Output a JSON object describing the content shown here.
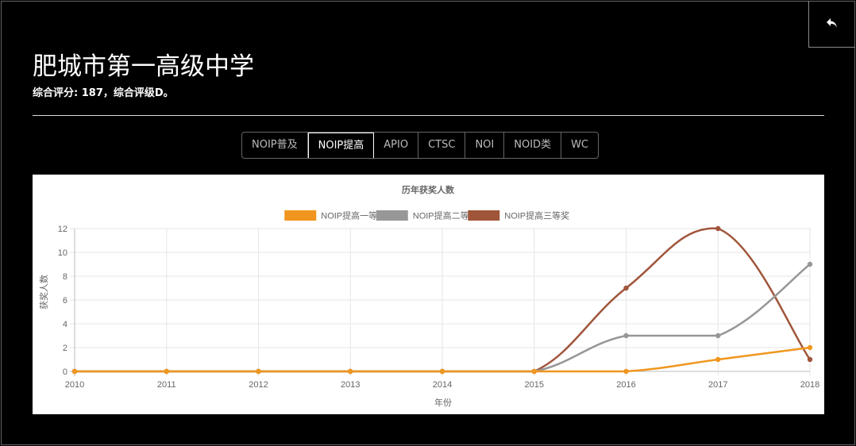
{
  "header": {
    "back_icon": "reply-arrow-icon",
    "title": "肥城市第一高级中学",
    "subtitle": "综合评分: 187，综合评级D。"
  },
  "tabs": [
    {
      "label": "NOIP普及",
      "active": false
    },
    {
      "label": "NOIP提高",
      "active": true
    },
    {
      "label": "APIO",
      "active": false
    },
    {
      "label": "CTSC",
      "active": false
    },
    {
      "label": "NOI",
      "active": false
    },
    {
      "label": "NOID类",
      "active": false
    },
    {
      "label": "WC",
      "active": false
    }
  ],
  "chart_data": {
    "type": "line",
    "title": "历年获奖人数",
    "xlabel": "年份",
    "ylabel": "获奖人数",
    "x": [
      "2010",
      "2011",
      "2012",
      "2013",
      "2014",
      "2015",
      "2016",
      "2017",
      "2018"
    ],
    "ylim": [
      0,
      12
    ],
    "yticks": [
      0,
      2,
      4,
      6,
      8,
      10,
      12
    ],
    "grid": true,
    "legend_position": "top",
    "series": [
      {
        "name": "NOIP提高一等奖",
        "color": "#F0961E",
        "values": [
          0,
          0,
          0,
          0,
          0,
          0,
          0,
          1,
          2
        ]
      },
      {
        "name": "NOIP提高二等奖",
        "color": "#979797",
        "values": [
          0,
          0,
          0,
          0,
          0,
          0,
          3,
          3,
          9
        ]
      },
      {
        "name": "NOIP提高三等奖",
        "color": "#A0553A",
        "values": [
          0,
          0,
          0,
          0,
          0,
          0,
          7,
          12,
          1
        ]
      }
    ]
  }
}
